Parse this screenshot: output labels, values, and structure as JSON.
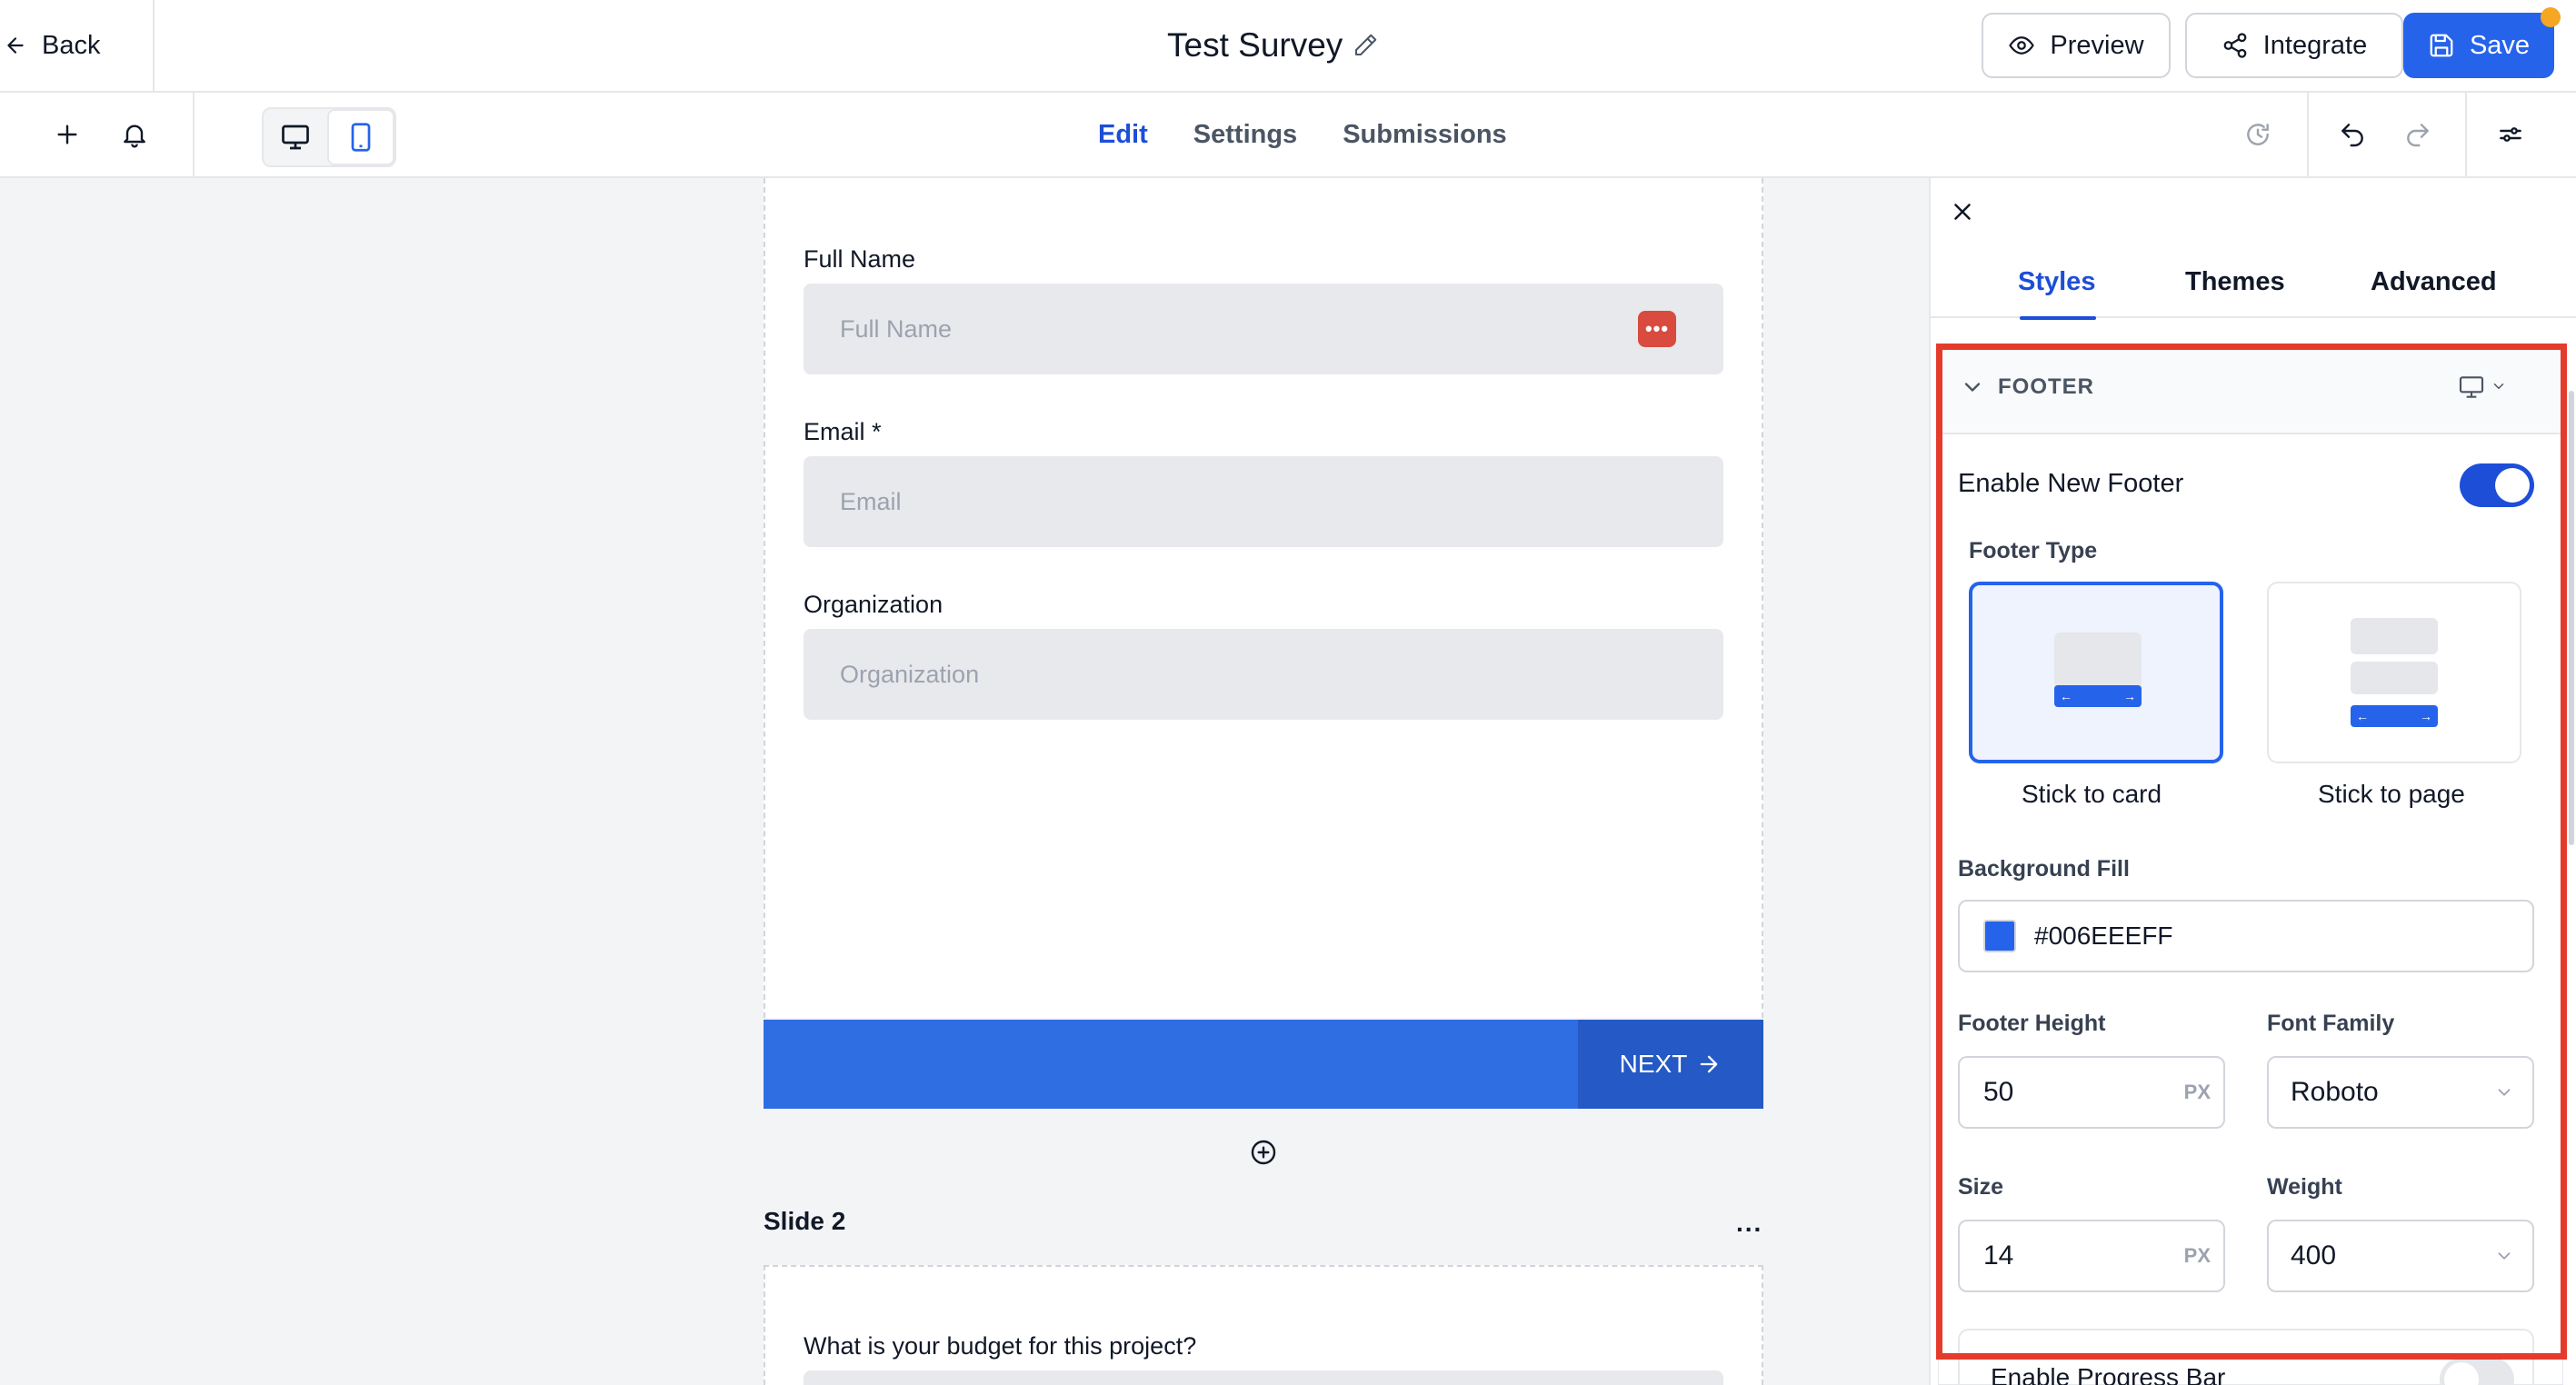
{
  "header": {
    "back_label": "Back",
    "title": "Test Survey",
    "preview_label": "Preview",
    "integrate_label": "Integrate",
    "save_label": "Save"
  },
  "subbar": {
    "tabs": [
      {
        "label": "Edit",
        "active": true
      },
      {
        "label": "Settings",
        "active": false
      },
      {
        "label": "Submissions",
        "active": false
      }
    ],
    "device_selected": "mobile"
  },
  "form": {
    "fields": [
      {
        "label": "Full Name",
        "placeholder": "Full Name"
      },
      {
        "label": "Email *",
        "placeholder": "Email"
      },
      {
        "label": "Organization",
        "placeholder": "Organization"
      }
    ],
    "badge_text": "•••",
    "next_label": "NEXT",
    "slide2_label": "Slide 2",
    "slide2_menu": "...",
    "slide2_question": "What is your budget for this project?"
  },
  "panel": {
    "tabs": [
      {
        "label": "Styles",
        "active": true
      },
      {
        "label": "Themes",
        "active": false
      },
      {
        "label": "Advanced",
        "active": false
      }
    ],
    "section_title": "FOOTER",
    "enable_footer_label": "Enable New Footer",
    "enable_footer_on": true,
    "footer_type_label": "Footer Type",
    "footer_types": [
      {
        "label": "Stick to card",
        "selected": true
      },
      {
        "label": "Stick to page",
        "selected": false
      }
    ],
    "background_fill_label": "Background Fill",
    "background_fill_value": "#006EEEFF",
    "footer_height_label": "Footer Height",
    "footer_height_value": "50",
    "font_family_label": "Font Family",
    "font_family_value": "Roboto",
    "size_label": "Size",
    "size_value": "14",
    "weight_label": "Weight",
    "weight_value": "400",
    "unit_label": "PX",
    "progress_bar_label": "Enable Progress Bar",
    "progress_bar_on": false
  },
  "colors": {
    "accent": "#2563eb",
    "footer_fill": "#006EEE",
    "highlight": "#e53b2c"
  }
}
